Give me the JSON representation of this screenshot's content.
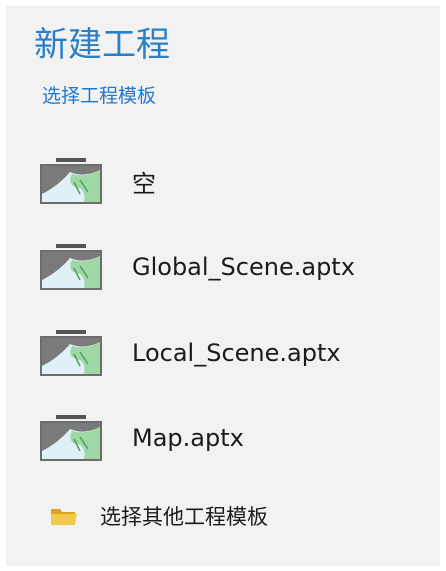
{
  "header": {
    "title": "新建工程",
    "subtitle": "选择工程模板"
  },
  "templates": [
    {
      "label": "空",
      "icon": "map-template-icon"
    },
    {
      "label": "Global_Scene.aptx",
      "icon": "map-template-icon"
    },
    {
      "label": "Local_Scene.aptx",
      "icon": "map-template-icon"
    },
    {
      "label": "Map.aptx",
      "icon": "map-template-icon"
    }
  ],
  "other_templates": {
    "label": "选择其他工程模板",
    "icon": "folder-icon"
  },
  "colors": {
    "accent": "#2a7fc9",
    "panel_bg": "#f2f2f2",
    "folder": "#e8b93a"
  }
}
